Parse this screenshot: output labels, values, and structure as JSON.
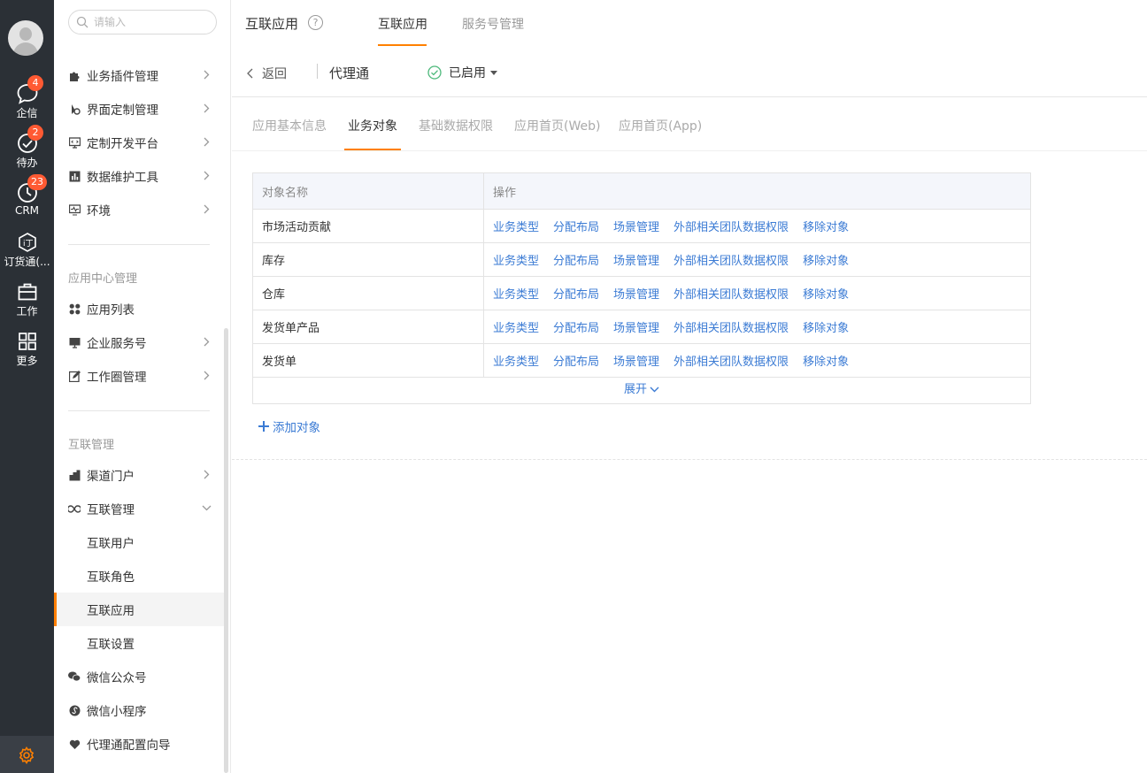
{
  "rail": {
    "items": [
      {
        "label": "企信",
        "badge": "4",
        "icon": "chat-bubble-icon"
      },
      {
        "label": "待办",
        "badge": "2",
        "icon": "check-circle-icon"
      },
      {
        "label": "CRM",
        "badge": "23",
        "icon": "clock-icon"
      },
      {
        "label": "订货通(...",
        "badge": "",
        "icon": "order-icon"
      },
      {
        "label": "工作",
        "badge": "",
        "icon": "briefcase-icon"
      },
      {
        "label": "更多",
        "badge": "",
        "icon": "grid-icon"
      }
    ],
    "settings_icon": "gear-icon",
    "accent": "#ff8000"
  },
  "menu": {
    "search_placeholder": "请输入",
    "items_top": [
      {
        "label": "业务插件管理",
        "icon": "puzzle-icon"
      },
      {
        "label": "界面定制管理",
        "icon": "palette-icon"
      },
      {
        "label": "定制开发平台",
        "icon": "monitor-code-icon"
      },
      {
        "label": "数据维护工具",
        "icon": "chart-icon"
      },
      {
        "label": "环境",
        "icon": "pulse-monitor-icon"
      }
    ],
    "group1_title": "应用中心管理",
    "group1": [
      {
        "label": "应用列表",
        "icon": "apps-icon"
      },
      {
        "label": "企业服务号",
        "icon": "desktop-icon"
      },
      {
        "label": "工作圈管理",
        "icon": "edit-icon"
      }
    ],
    "group2_title": "互联管理",
    "group2": [
      {
        "label": "渠道门户",
        "icon": "building-icon"
      },
      {
        "label": "互联管理",
        "icon": "infinity-icon"
      }
    ],
    "sub_items": [
      "互联用户",
      "互联角色",
      "互联应用",
      "互联设置"
    ],
    "group2_more": [
      {
        "label": "微信公众号",
        "icon": "wechat-icon"
      },
      {
        "label": "微信小程序",
        "icon": "miniprogram-icon"
      },
      {
        "label": "代理通配置向导",
        "icon": "heart-shield-icon"
      }
    ]
  },
  "header": {
    "title": "互联应用",
    "help": "?",
    "tabs": [
      "互联应用",
      "服务号管理"
    ]
  },
  "subheader": {
    "back": "返回",
    "app_name": "代理通",
    "status": "已启用",
    "status_color": "#4cb87a"
  },
  "tabs": [
    "应用基本信息",
    "业务对象",
    "基础数据权限",
    "应用首页(Web)",
    "应用首页(App)"
  ],
  "table": {
    "headers": [
      "对象名称",
      "操作"
    ],
    "rows": [
      {
        "name": "市场活动贡献"
      },
      {
        "name": "库存"
      },
      {
        "name": "仓库"
      },
      {
        "name": "发货单产品"
      },
      {
        "name": "发货单"
      }
    ],
    "actions": [
      "业务类型",
      "分配布局",
      "场景管理",
      "外部相关团队数据权限",
      "移除对象"
    ],
    "expand": "展开",
    "link_color": "#3b7bd4"
  },
  "add_object": "添加对象"
}
